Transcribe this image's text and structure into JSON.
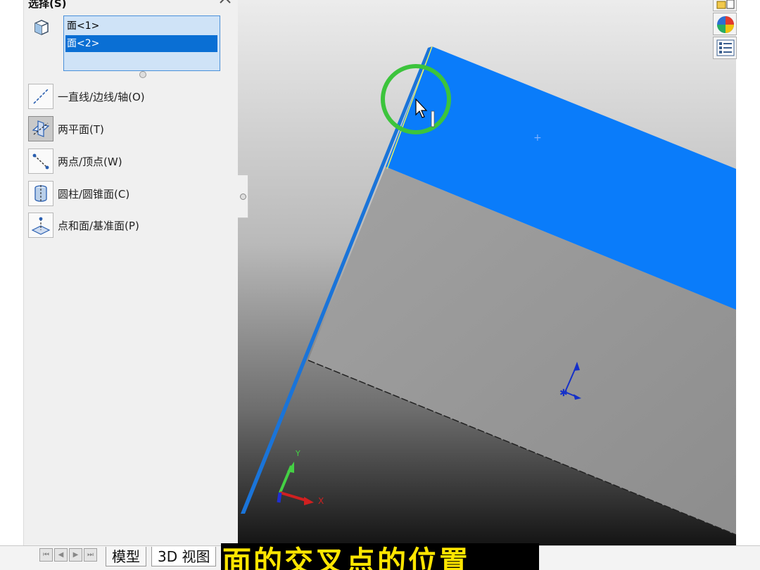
{
  "selection_panel": {
    "title": "选择(S)",
    "items": [
      {
        "label": "面<1>",
        "selected": false
      },
      {
        "label": "面<2>",
        "selected": true
      }
    ]
  },
  "options": [
    {
      "label": "一直线/边线/轴(O)",
      "icon": "line-axis-icon",
      "pressed": false
    },
    {
      "label": "两平面(T)",
      "icon": "two-planes-icon",
      "pressed": true
    },
    {
      "label": "两点/顶点(W)",
      "icon": "two-points-icon",
      "pressed": false
    },
    {
      "label": "圆柱/圆锥面(C)",
      "icon": "cylinder-icon",
      "pressed": false
    },
    {
      "label": "点和面/基准面(P)",
      "icon": "point-plane-icon",
      "pressed": false
    }
  ],
  "triad": {
    "y_label": "Y",
    "x_label": "X"
  },
  "bottom_tabs": [
    {
      "label": "模型",
      "current": false
    },
    {
      "label": "3D 视图",
      "current": true
    }
  ],
  "caption": "面的交叉点的位置",
  "colors": {
    "selected_face": "#0a7cfa",
    "highlight_circle": "#3cc43c",
    "caption_text": "#ffe600",
    "selection_list_bg": "#cfe3f7"
  },
  "right_toolbar_icons": [
    "display-pane-icon",
    "appearance-icon",
    "property-list-icon"
  ]
}
